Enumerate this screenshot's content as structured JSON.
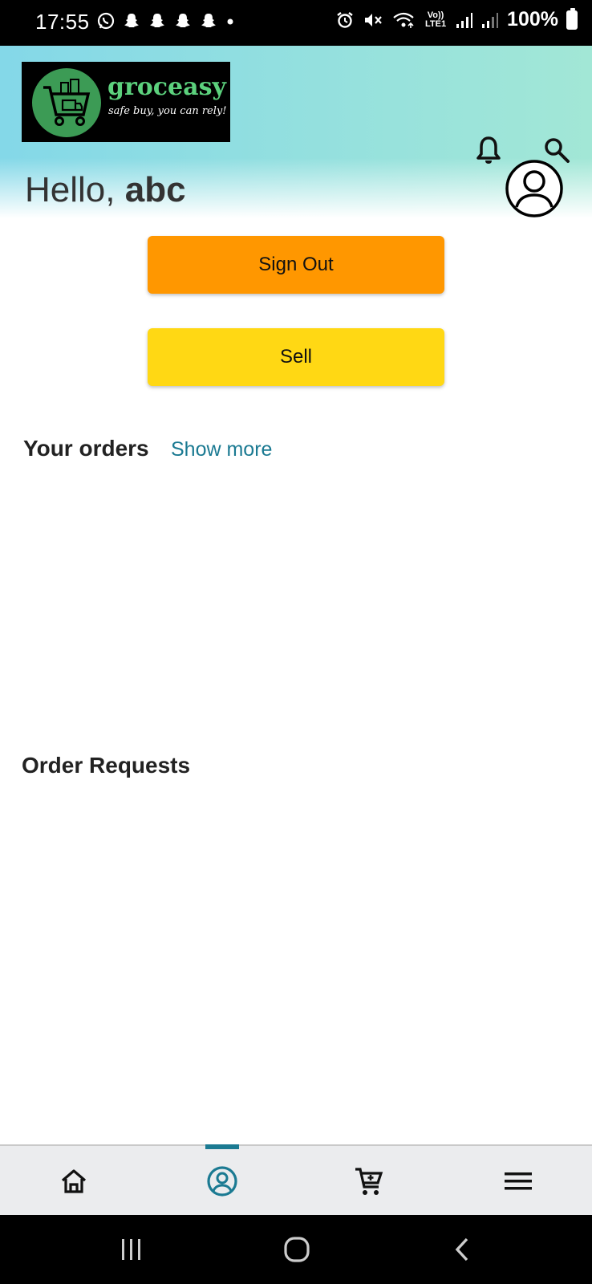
{
  "status_bar": {
    "time": "17:55",
    "battery": "100%",
    "network_label": "Vo)) LTE1",
    "icons": [
      "whatsapp-icon",
      "snapchat-icon",
      "snapchat-icon",
      "snapchat-icon",
      "snapchat-icon",
      "dot-icon",
      "alarm-icon",
      "mute-icon",
      "wifi-icon",
      "signal-icon",
      "signal-icon",
      "battery-icon"
    ]
  },
  "header": {
    "logo_name": "groceasy",
    "logo_tagline": "safe buy, you can rely!",
    "greeting_prefix": "Hello, ",
    "user_name": "abc"
  },
  "actions": {
    "sign_out_label": "Sign Out",
    "sell_label": "Sell"
  },
  "orders": {
    "title": "Your orders",
    "show_more_label": "Show more"
  },
  "order_requests": {
    "title": "Order Requests"
  },
  "bottom_nav": {
    "items": [
      "home-icon",
      "account-icon",
      "cart-icon",
      "menu-icon"
    ],
    "active": "account-icon"
  },
  "colors": {
    "accent": "#1b7a92",
    "sign_out_button": "#ff9700",
    "sell_button": "#ffd814",
    "header_gradient_start": "#84d8e8",
    "header_gradient_end": "#a2e7d6",
    "logo_green": "#5cd17d"
  }
}
